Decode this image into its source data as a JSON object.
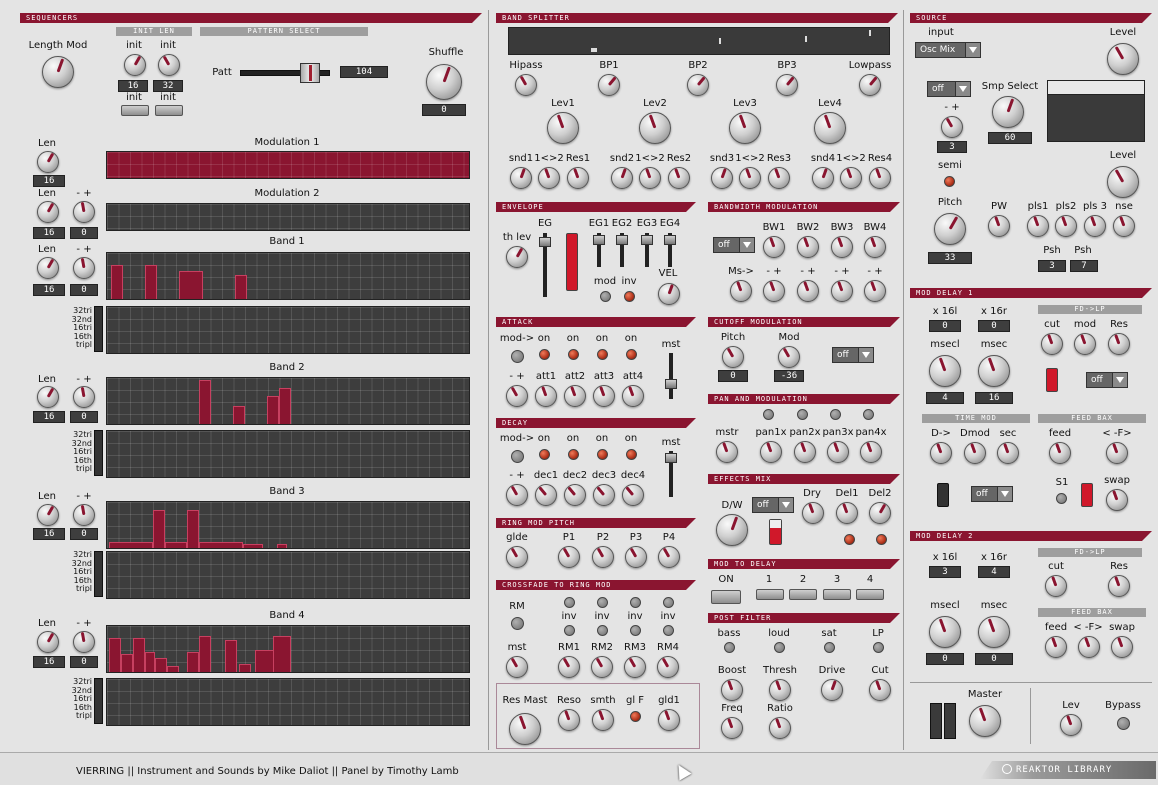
{
  "sequencers": {
    "title": "SEQUENCERS",
    "length_mod": "Length Mod",
    "init_len": "INIT LEN",
    "pattern_select": "PATTERN SELECT",
    "init1": "init",
    "init2": "init",
    "init3": "init",
    "init4": "init",
    "len1_val": "16",
    "len2_val": "32",
    "patt": "Patt",
    "patt_val": "104",
    "shuffle": "Shuffle",
    "shuffle_val": "0",
    "rows": [
      {
        "len": "Len",
        "len_val": "16",
        "title": "Modulation 1"
      },
      {
        "len": "Len",
        "minus_plus": "- +",
        "len_val": "16",
        "mp_val": "0",
        "title": "Modulation 2"
      },
      {
        "len": "Len",
        "minus_plus": "- +",
        "len_val": "16",
        "mp_val": "0",
        "title": "Band 1"
      },
      {
        "len": "Len",
        "minus_plus": "- +",
        "len_val": "16",
        "mp_val": "0",
        "title": "Band 2"
      },
      {
        "len": "Len",
        "minus_plus": "- +",
        "len_val": "16",
        "mp_val": "0",
        "title": "Band 3"
      },
      {
        "len": "Len",
        "minus_plus": "- +",
        "len_val": "16",
        "mp_val": "0",
        "title": "Band 4"
      }
    ],
    "tri_labels": [
      "32tri",
      "32nd",
      "16tri",
      "16th",
      "tripl"
    ]
  },
  "band_splitter": {
    "title": "BAND SPLITTER",
    "hipass": "Hipass",
    "bp1": "BP1",
    "bp2": "BP2",
    "bp3": "BP3",
    "lowpass": "Lowpass",
    "lev1": "Lev1",
    "lev2": "Lev2",
    "lev3": "Lev3",
    "lev4": "Lev4",
    "snd_row": [
      "snd1",
      "1<>2",
      "Res1",
      "snd2",
      "1<>2",
      "Res2",
      "snd3",
      "1<>2",
      "Res3",
      "snd4",
      "1<>2",
      "Res4"
    ]
  },
  "envelope": {
    "title": "ENVELOPE",
    "th_lev": "th lev",
    "eg": "EG",
    "eg1": "EG1",
    "eg2": "EG2",
    "eg3": "EG3",
    "eg4": "EG4",
    "mod": "mod",
    "inv": "inv",
    "vel": "VEL"
  },
  "bw_mod": {
    "title": "BANDWIDTH MODULATION",
    "off": "off",
    "bw1": "BW1",
    "bw2": "BW2",
    "bw3": "BW3",
    "bw4": "BW4",
    "ms": "Ms->",
    "mp1": "- +",
    "mp2": "- +",
    "mp3": "- +",
    "mp4": "- +"
  },
  "attack": {
    "title": "ATTACK",
    "mod": "mod->",
    "on1": "on",
    "on2": "on",
    "on3": "on",
    "on4": "on",
    "mst": "mst",
    "mp": "- +",
    "att1": "att1",
    "att2": "att2",
    "att3": "att3",
    "att4": "att4"
  },
  "decay": {
    "title": "DECAY",
    "mod": "mod->",
    "on1": "on",
    "on2": "on",
    "on3": "on",
    "on4": "on",
    "mst": "mst",
    "mp": "- +",
    "dec1": "dec1",
    "dec2": "dec2",
    "dec3": "dec3",
    "dec4": "dec4"
  },
  "ring_mod_pitch": {
    "title": "RING MOD PITCH",
    "glide": "glde",
    "p1": "P1",
    "p2": "P2",
    "p3": "P3",
    "p4": "P4"
  },
  "crossfade": {
    "title": "CROSSFADE TO RING MOD",
    "rm": "RM",
    "inv1": "inv",
    "inv2": "inv",
    "inv3": "inv",
    "inv4": "inv",
    "mst": "mst",
    "rm1": "RM1",
    "rm2": "RM2",
    "rm3": "RM3",
    "rm4": "RM4"
  },
  "res_mast": {
    "res_mast": "Res Mast",
    "reso": "Reso",
    "smth": "smth",
    "glf": "gl F",
    "gld1": "gld1"
  },
  "cutoff_mod": {
    "title": "CUTOFF MODULATION",
    "pitch": "Pitch",
    "mod": "Mod",
    "pitch_val": "0",
    "mod_val": "-36",
    "off": "off"
  },
  "pan_mod": {
    "title": "PAN AND MODULATION",
    "mstr": "mstr",
    "pan1": "pan1x",
    "pan2": "pan2x",
    "pan3": "pan3x",
    "pan4": "pan4x"
  },
  "effects_mix": {
    "title": "EFFECTS MIX",
    "dw": "D/W",
    "off": "off",
    "dry": "Dry",
    "del1": "Del1",
    "del2": "Del2"
  },
  "mod_to_delay": {
    "title": "MOD TO DELAY",
    "on": "ON",
    "b1": "1",
    "b2": "2",
    "b3": "3",
    "b4": "4"
  },
  "post_filter": {
    "title": "POST FILTER",
    "bass": "bass",
    "loud": "loud",
    "sat": "sat",
    "lp": "LP",
    "boost": "Boost",
    "thresh": "Thresh",
    "drive": "Drive",
    "cut": "Cut",
    "freq": "Freq",
    "ratio": "Ratio"
  },
  "source": {
    "title": "SOURCE",
    "input": "input",
    "level1": "Level",
    "osc_mix": "Osc Mix",
    "off": "off",
    "smp_select": "Smp Select",
    "mp": "- +",
    "mp_val": "3",
    "smp_val": "60",
    "semi": "semi",
    "level2": "Level",
    "pitch": "Pitch",
    "pitch_val": "33",
    "pw": "PW",
    "pls1": "pls1",
    "pls2": "pls2",
    "pls3": "pls 3",
    "nse": "nse",
    "psh1": "Psh",
    "psh2": "Psh",
    "psh1_val": "3",
    "psh2_val": "7"
  },
  "mod_delay1": {
    "title": "MOD DELAY 1",
    "x16l": "x 16l",
    "x16r": "x 16r",
    "x16l_val": "0",
    "x16r_val": "0",
    "msecl": "msecl",
    "msec": "msec",
    "msecl_val": "4",
    "msec_val": "16",
    "fd_lp": "FD->LP",
    "cut": "cut",
    "mod": "mod",
    "res": "Res",
    "off": "off",
    "time_mod": "TIME MOD",
    "feed_bax": "FEED BAX",
    "d": "D->",
    "dmod": "Dmod",
    "sec": "sec",
    "feed": "feed",
    "f": "< -F>",
    "s1": "S1",
    "swap": "swap",
    "off2": "off"
  },
  "mod_delay2": {
    "title": "MOD DELAY 2",
    "x16l": "x 16l",
    "x16r": "x 16r",
    "x16l_val": "3",
    "x16r_val": "4",
    "fd_lp": "FD->LP",
    "cut": "cut",
    "res": "Res",
    "msecl": "msecl",
    "msec": "msec",
    "msecl_val": "0",
    "msec_val": "0",
    "feed_bax": "FEED BAX",
    "feed": "feed",
    "f": "< -F>",
    "swap": "swap"
  },
  "master": {
    "master": "Master",
    "lev": "Lev",
    "bypass": "Bypass"
  },
  "footer": {
    "credits": "VIERRING  ||  Instrument and Sounds by Mike Daliot  ||  Panel by Timothy Lamb",
    "logo": "REAKTOR LIBRARY"
  },
  "colors": {
    "accent": "#8a1530",
    "led": "#c0442a",
    "bg": "#e4e4e4"
  }
}
